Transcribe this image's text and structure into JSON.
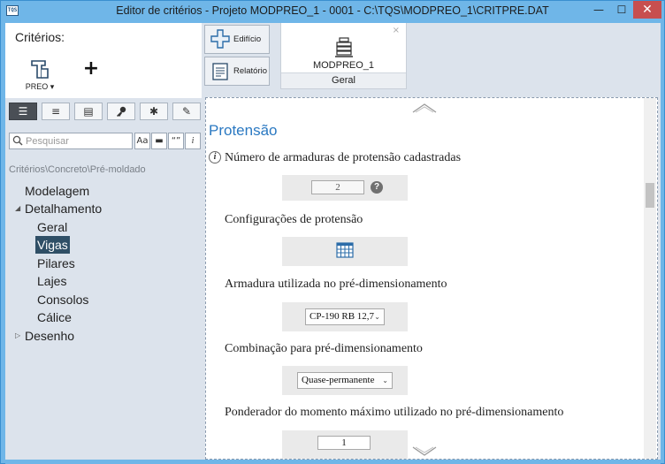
{
  "window": {
    "title": "Editor de critérios - Projeto MODPREO_1 - 0001 - C:\\TQS\\MODPREO_1\\CRITPRE.DAT",
    "app_icon_text": "TQS",
    "minimize": "—",
    "maximize": "☐",
    "close": "✕"
  },
  "left_panel": {
    "heading": "Critérios:",
    "preo_label": "PREO ▾",
    "add_label": "+",
    "toolbar": [
      {
        "name": "list-view-icon",
        "glyph": "☰"
      },
      {
        "name": "center-align-icon",
        "glyph": "≡"
      },
      {
        "name": "grouped-view-icon",
        "glyph": "▤"
      },
      {
        "name": "key-icon",
        "glyph": "🔑"
      },
      {
        "name": "asterisk-icon",
        "glyph": "✱"
      },
      {
        "name": "pencil-icon",
        "glyph": "✎"
      }
    ],
    "search": {
      "placeholder": "Pesquisar"
    },
    "search_options": [
      "Aa",
      "▬",
      "“”",
      "i"
    ],
    "breadcrumb": "Critérios\\Concreto\\Pré-moldado",
    "tree": {
      "modelagem": "Modelagem",
      "detalhamento": "Detalhamento",
      "geral": "Geral",
      "vigas": "Vigas",
      "pilares": "Pilares",
      "lajes": "Lajes",
      "consolos": "Consolos",
      "calice": "Cálice",
      "desenho": "Desenho"
    }
  },
  "right_panel": {
    "tabs": {
      "edificio": "Edifício",
      "relatorio": "Relatório"
    },
    "document": {
      "name": "MODPREO_1",
      "subtab": "Geral",
      "close": "×"
    },
    "section_title": "Protensão",
    "fields": {
      "numero_armaduras": {
        "label": "Número de armaduras de protensão cadastradas",
        "value": "2",
        "help": "?"
      },
      "configuracoes": {
        "label": "Configurações de protensão"
      },
      "armadura_utilizada": {
        "label": "Armadura utilizada no pré-dimensionamento",
        "value": "CP-190 RB 12,7"
      },
      "combinacao": {
        "label": "Combinação para pré-dimensionamento",
        "value": "Quase-permanente"
      },
      "ponderador": {
        "label": "Ponderador do momento máximo utilizado no pré-dimensionamento",
        "value": "1"
      }
    }
  }
}
